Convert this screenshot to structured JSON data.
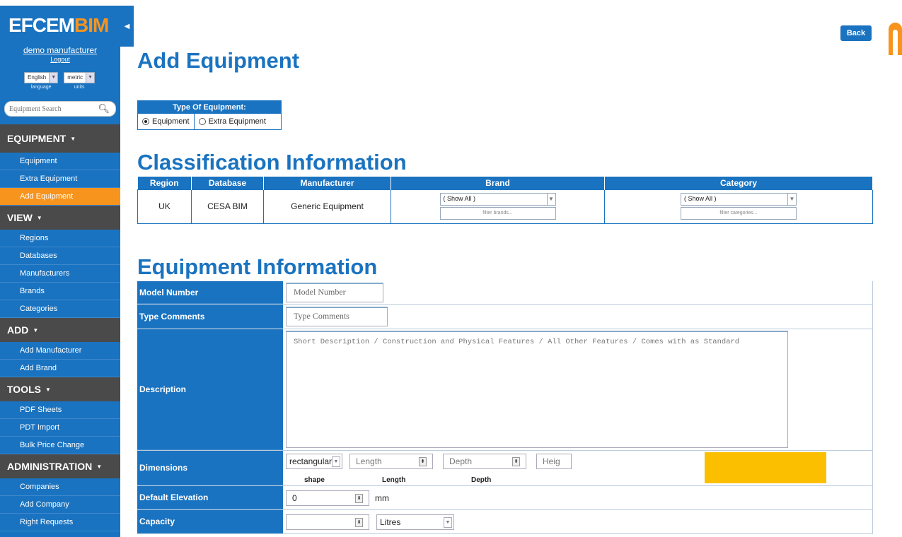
{
  "brand": {
    "logo_part1": "EFCEM",
    "logo_part2": "BIM",
    "accent": "#1a73c0",
    "orange": "#f7941d"
  },
  "user": {
    "name": "demo manufacturer",
    "logout": "Logout"
  },
  "prefs": {
    "language_value": "English",
    "language_label": "language",
    "units_value": "metric",
    "units_label": "units"
  },
  "search": {
    "placeholder": "Equipment Search"
  },
  "menu": {
    "equipment": {
      "title": "EQUIPMENT",
      "items": [
        "Equipment",
        "Extra Equipment",
        "Add Equipment"
      ]
    },
    "view": {
      "title": "VIEW",
      "items": [
        "Regions",
        "Databases",
        "Manufacturers",
        "Brands",
        "Categories"
      ]
    },
    "add": {
      "title": "ADD",
      "items": [
        "Add Manufacturer",
        "Add Brand"
      ]
    },
    "tools": {
      "title": "TOOLS",
      "items": [
        "PDF Sheets",
        "PDT Import",
        "Bulk Price Change"
      ]
    },
    "admin": {
      "title": "ADMINISTRATION",
      "items": [
        "Companies",
        "Add Company",
        "Right Requests"
      ]
    }
  },
  "header": {
    "back_label": "Back",
    "page_title": "Add Equipment"
  },
  "type_of_equipment": {
    "title": "Type Of Equipment:",
    "options": [
      "Equipment",
      "Extra Equipment"
    ],
    "selected": "Equipment"
  },
  "classification": {
    "title": "Classification Information",
    "columns": [
      "Region",
      "Database",
      "Manufacturer",
      "Brand",
      "Category"
    ],
    "row": {
      "region": "UK",
      "database": "CESA BIM",
      "manufacturer": "Generic Equipment"
    },
    "brand_select": "( Show All )",
    "brand_filter": "filter brands...",
    "category_select": "( Show All )",
    "category_filter": "filter categories..."
  },
  "equipment_info": {
    "title": "Equipment Information",
    "model_number_label": "Model Number",
    "model_number_placeholder": "Model Number",
    "type_comments_label": "Type Comments",
    "type_comments_placeholder": "Type Comments",
    "description_label": "Description",
    "description_placeholder": "Short Description / Construction and Physical Features / All Other Features / Comes with as Standard",
    "dimensions_label": "Dimensions",
    "shape_value": "rectangular",
    "shape_label": "shape",
    "length_placeholder": "Length",
    "length_label": "Length",
    "depth_placeholder": "Depth",
    "depth_label": "Depth",
    "height_placeholder": "Heig",
    "default_elevation_label": "Default Elevation",
    "default_elevation_value": "0",
    "elevation_unit": "mm",
    "capacity_label": "Capacity",
    "capacity_unit": "Litres"
  }
}
